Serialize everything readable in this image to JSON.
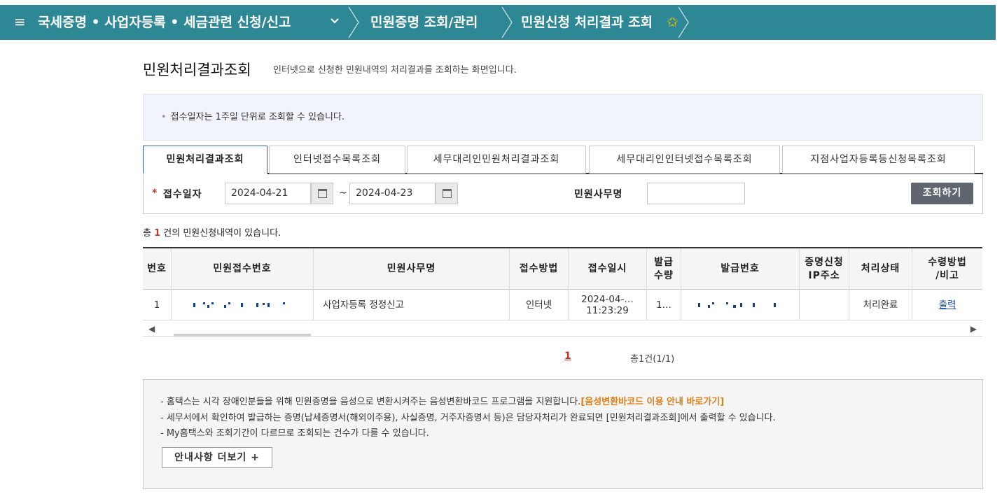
{
  "nav": {
    "menu_icon": "≡",
    "crumb1": "국세증명 • 사업자등록 • 세금관련 신청/신고",
    "crumb2": "민원증명 조회/관리",
    "crumb3": "민원신청 처리결과 조회",
    "star": "✩",
    "chevron": "⌄"
  },
  "page": {
    "title": "민원처리결과조회",
    "desc": "인터넷으로 신청한 민원내역의 처리결과를 조회하는 화면입니다."
  },
  "info": {
    "bullet": "•",
    "text": "접수일자는 1주일 단위로 조회할 수 있습니다."
  },
  "tabs": [
    {
      "label": "민원처리결과조회",
      "active": true
    },
    {
      "label": "인터넷접수목록조회",
      "active": false
    },
    {
      "label": "세무대리인민원처리결과조회",
      "active": false
    },
    {
      "label": "세무대리인인터넷접수목록조회",
      "active": false
    },
    {
      "label": "지점사업자등록등신청목록조회",
      "active": false
    }
  ],
  "search": {
    "required_mark": "*",
    "date_label": "접수일자",
    "date_from": "2024-04-21",
    "date_to": "2024-04-23",
    "tilde": "~",
    "name_label": "민원사무명",
    "name_value": "",
    "button": "조회하기"
  },
  "count": {
    "prefix": "총",
    "value": "1",
    "suffix": "건의 민원신청내역이 있습니다."
  },
  "table": {
    "headers": {
      "no": "번호",
      "receipt_no": "민원접수번호",
      "name": "민원사무명",
      "method": "접수방법",
      "date": "접수일시",
      "qty": "발급\n수량",
      "issue_no": "발급번호",
      "ip": "증명신청\nIP주소",
      "status": "처리상태",
      "receive": "수령방법\n/비고"
    },
    "row": {
      "no": "1",
      "name": "사업자등록 정정신고",
      "method": "인터넷",
      "date_line1": "2024-04-…",
      "date_line2": "11:23:29",
      "qty": "1…",
      "ip": "",
      "status": "처리완료",
      "receive": "출력"
    }
  },
  "scroll": {
    "left": "◀",
    "right": "▶"
  },
  "pager": {
    "current": "1",
    "total": "총1건(1/1)"
  },
  "notice": {
    "line1": "- 홈택스는 시각 장애인분들을 위해 민원증명을 음성으로 변환시켜주는 음성변환바코드 프로그램을 지원합니다.",
    "line1_link": "[음성변환바코드 이용 안내 바로가기]",
    "line2": "- 세무서에서 확인하여 발급하는 증명(납세증명서(해외이주용), 사실증명, 거주자증명서 등)은 담당자처리가 완료되면 [민원처리결과조회]에서 출력할 수 있습니다.",
    "line3": "- My홈택스와 조회기간이 다르므로 조회되는 건수가 다를 수 있습니다.",
    "more_button": "안내사항 더보기 +"
  },
  "colors": {
    "nav_bg": "#2e8795",
    "accent_red": "#c0392b",
    "link_orange": "#d9801a",
    "button_dark": "#5f6670"
  }
}
